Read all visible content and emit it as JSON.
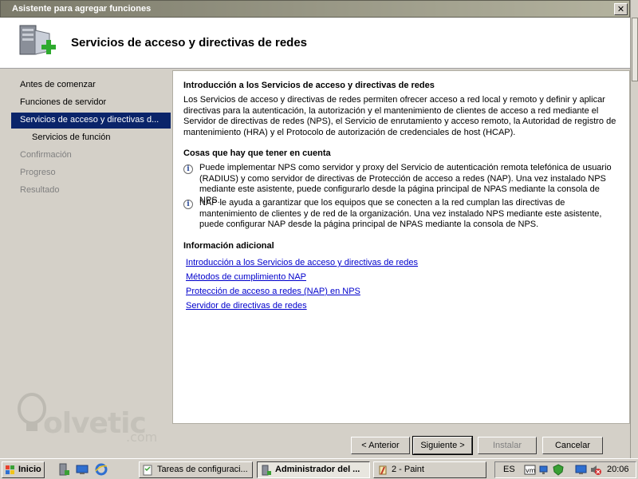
{
  "window": {
    "title": "Asistente para agregar funciones",
    "close_glyph": "✕",
    "header_title": "Servicios de acceso y directivas de redes",
    "header_icon": "server-add-icon"
  },
  "nav": {
    "items": [
      {
        "label": "Antes de comenzar",
        "state": "normal"
      },
      {
        "label": "Funciones de servidor",
        "state": "normal"
      },
      {
        "label": "Servicios de acceso y directivas d...",
        "state": "active"
      },
      {
        "label": "Servicios de función",
        "state": "sub"
      },
      {
        "label": "Confirmación",
        "state": "disabled"
      },
      {
        "label": "Progreso",
        "state": "disabled"
      },
      {
        "label": "Resultado",
        "state": "disabled"
      }
    ]
  },
  "content": {
    "intro_heading": "Introducción a los Servicios de acceso y directivas de redes",
    "intro_text": "Los Servicios de acceso y directivas de redes permiten ofrecer acceso a red local y remoto y definir y aplicar directivas para la autenticación, la autorización y el mantenimiento de clientes de acceso a red mediante el Servidor de directivas de redes (NPS), el Servicio de enrutamiento y acceso remoto, la Autoridad de registro de mantenimiento (HRA) y el Protocolo de autorización de credenciales de host (HCAP).",
    "notes_heading": "Cosas que hay que tener en cuenta",
    "notes": [
      "Puede implementar NPS como servidor y proxy del Servicio de autenticación remota telefónica de usuario (RADIUS) y como servidor de directivas de Protección de acceso a redes (NAP). Una vez instalado NPS mediante este asistente, puede configurarlo desde la página principal de NPAS mediante la consola de NPS.",
      "NAP le ayuda a garantizar que los equipos que se conecten a la red cumplan las directivas de mantenimiento de clientes y de red de la organización. Una vez instalado NPS mediante este asistente, puede configurar NAP desde la página principal de NPAS mediante la consola de NPS."
    ],
    "info_icon_glyph": "i",
    "more_heading": "Información adicional",
    "links": [
      "Introducción a los Servicios de acceso y directivas de redes",
      "Métodos de cumplimiento NAP",
      "Protección de acceso a redes (NAP) en NPS",
      "Servidor de directivas de redes"
    ]
  },
  "watermark": {
    "text": "olvetic",
    "suffix": ".com"
  },
  "buttons": {
    "back": "< Anterior",
    "next": "Siguiente >",
    "install": "Instalar",
    "cancel": "Cancelar"
  },
  "taskbar": {
    "start": "Inicio",
    "quick_launch": [
      "server-manager-icon",
      "show-desktop-icon",
      "internet-explorer-icon"
    ],
    "tasks": [
      {
        "label": "Tareas de configuraci...",
        "icon": "tasks-icon",
        "active": false
      },
      {
        "label": "Administrador del ...",
        "icon": "server-manager-icon",
        "active": true
      },
      {
        "label": "2 - Paint",
        "icon": "paint-icon",
        "active": false
      }
    ],
    "language": "ES",
    "clock": "20:06",
    "tray_icons": [
      "vm-icon",
      "network-icon",
      "security-icon",
      "monitor-icon",
      "volume-muted-icon"
    ]
  },
  "colors": {
    "selection": "#0a246a",
    "link": "#0000cc",
    "titlebar": "#7b7a6a"
  }
}
